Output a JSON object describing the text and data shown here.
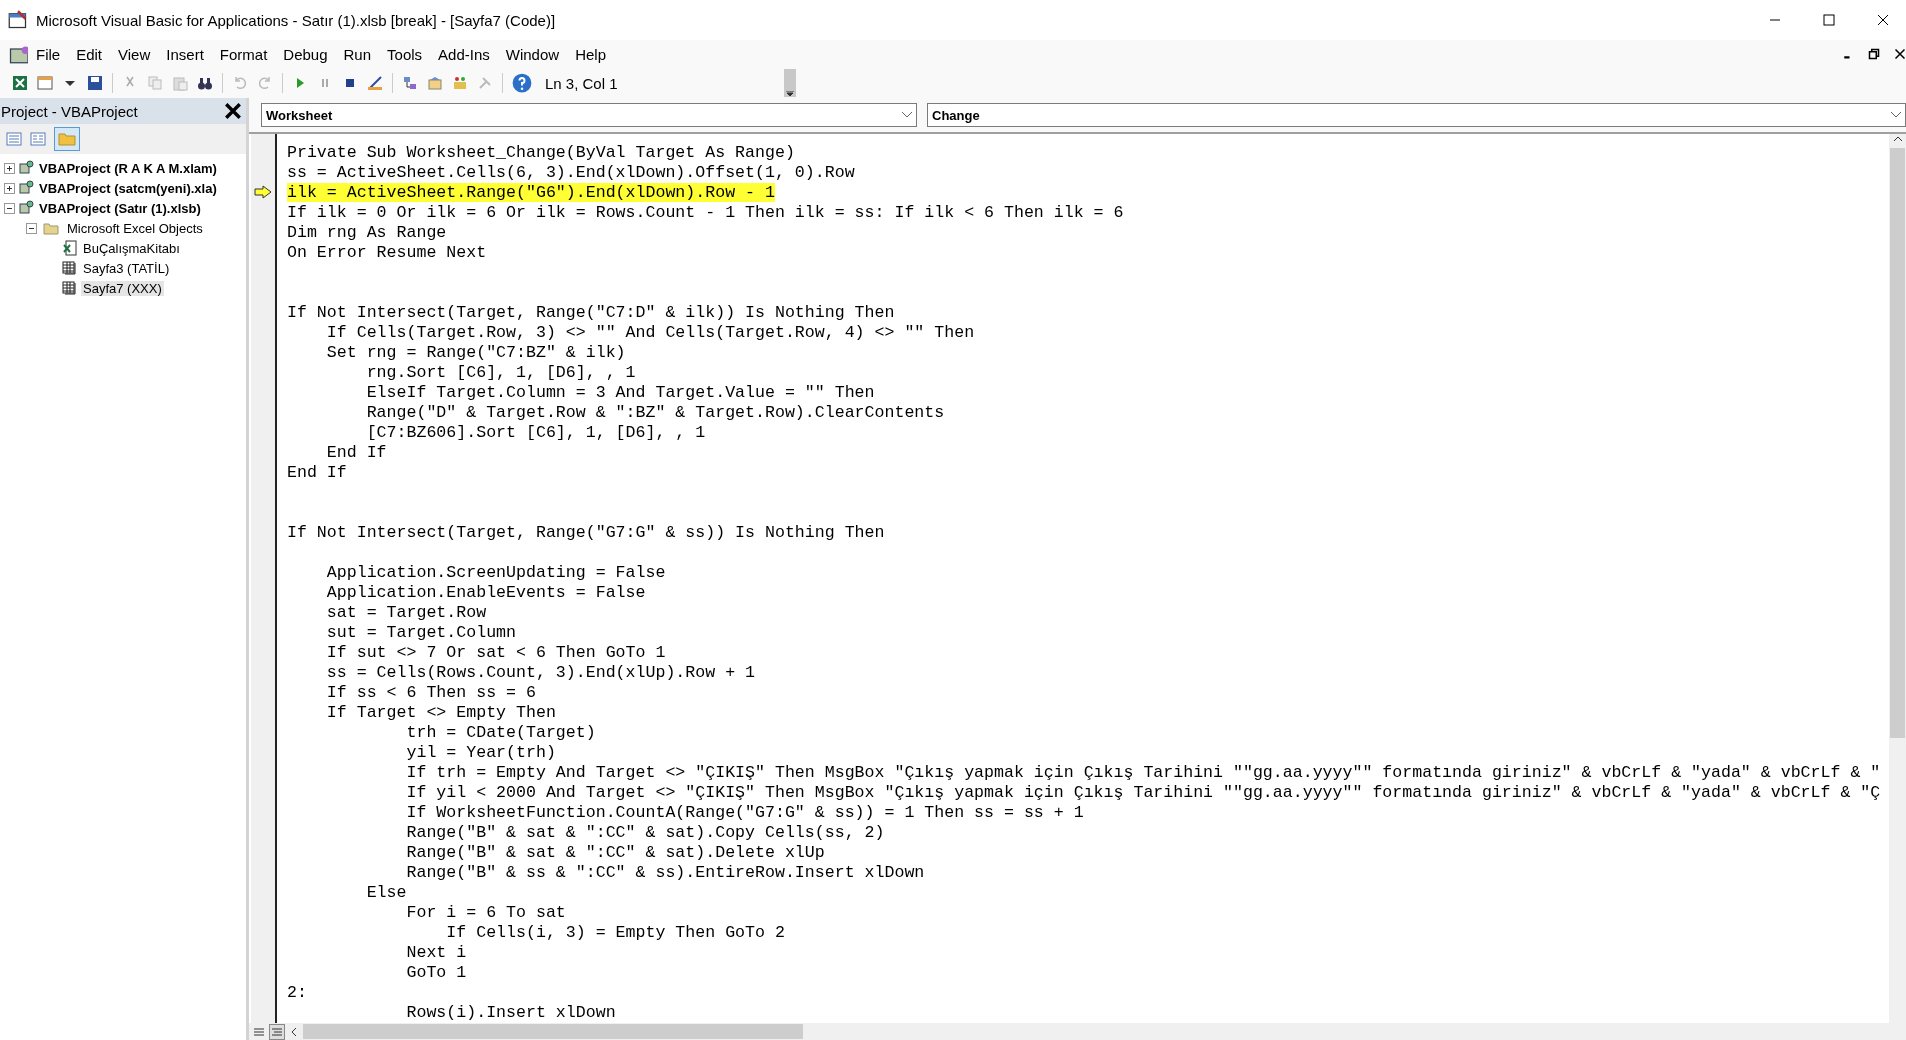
{
  "window": {
    "title": "Microsoft Visual Basic for Applications - Satır (1).xlsb [break] - [Sayfa7 (Code)]"
  },
  "menu": [
    {
      "label": "File"
    },
    {
      "label": "Edit"
    },
    {
      "label": "View"
    },
    {
      "label": "Insert"
    },
    {
      "label": "Format"
    },
    {
      "label": "Debug"
    },
    {
      "label": "Run"
    },
    {
      "label": "Tools"
    },
    {
      "label": "Add-Ins"
    },
    {
      "label": "Window"
    },
    {
      "label": "Help"
    }
  ],
  "toolbar": {
    "position": "Ln 3, Col 1"
  },
  "project": {
    "title": "Project - VBAProject",
    "folders_toggle": {
      "selected": true
    },
    "tree": [
      {
        "label": "VBAProject (R A K A M.xlam)",
        "kind": "project",
        "expanded": false,
        "selected": false
      },
      {
        "label": "VBAProject (satcm(yeni).xla)",
        "kind": "project",
        "expanded": false,
        "selected": false
      },
      {
        "label": "VBAProject (Satır (1).xlsb)",
        "kind": "project",
        "expanded": true,
        "selected": false,
        "children": [
          {
            "label": "Microsoft Excel Objects",
            "kind": "folder",
            "expanded": true,
            "selected": false,
            "children": [
              {
                "label": "BuÇalışmaKitabı",
                "kind": "workbook",
                "selected": false
              },
              {
                "label": "Sayfa3 (TATİL)",
                "kind": "sheet",
                "selected": false
              },
              {
                "label": "Sayfa7 (XXX)",
                "kind": "sheet",
                "selected": true
              }
            ]
          }
        ]
      }
    ]
  },
  "code": {
    "object": "Worksheet",
    "procedure": "Change",
    "lines": [
      {
        "kind": "code",
        "text": "Private Sub Worksheet_Change(ByVal Target As Range)",
        "current": false
      },
      {
        "kind": "code",
        "text": "ss = ActiveSheet.Cells(6, 3).End(xlDown).Offset(1, 0).Row",
        "current": false
      },
      {
        "kind": "code",
        "text": "ilk = ActiveSheet.Range(\"G6\").End(xlDown).Row - 1",
        "current": true
      },
      {
        "kind": "code",
        "text": "If ilk = 0 Or ilk = 6 Or ilk = Rows.Count - 1 Then ilk = ss: If ilk < 6 Then ilk = 6",
        "current": false
      },
      {
        "kind": "code",
        "text": "Dim rng As Range",
        "current": false
      },
      {
        "kind": "code",
        "text": "On Error Resume Next",
        "current": false
      },
      {
        "kind": "blank"
      },
      {
        "kind": "blank"
      },
      {
        "kind": "code",
        "text": "If Not Intersect(Target, Range(\"C7:D\" & ilk)) Is Nothing Then",
        "current": false
      },
      {
        "kind": "code",
        "text": "    If Cells(Target.Row, 3) <> \"\" And Cells(Target.Row, 4) <> \"\" Then",
        "current": false
      },
      {
        "kind": "code",
        "text": "    Set rng = Range(\"C7:BZ\" & ilk)",
        "current": false
      },
      {
        "kind": "code",
        "text": "        rng.Sort [C6], 1, [D6], , 1",
        "current": false
      },
      {
        "kind": "code",
        "text": "        ElseIf Target.Column = 3 And Target.Value = \"\" Then",
        "current": false
      },
      {
        "kind": "code",
        "text": "        Range(\"D\" & Target.Row & \":BZ\" & Target.Row).ClearContents",
        "current": false
      },
      {
        "kind": "code",
        "text": "        [C7:BZ606].Sort [C6], 1, [D6], , 1",
        "current": false
      },
      {
        "kind": "code",
        "text": "    End If",
        "current": false
      },
      {
        "kind": "code",
        "text": "End If",
        "current": false
      },
      {
        "kind": "blank"
      },
      {
        "kind": "blank"
      },
      {
        "kind": "code",
        "text": "If Not Intersect(Target, Range(\"G7:G\" & ss)) Is Nothing Then",
        "current": false
      },
      {
        "kind": "blank"
      },
      {
        "kind": "code",
        "text": "    Application.ScreenUpdating = False",
        "current": false
      },
      {
        "kind": "code",
        "text": "    Application.EnableEvents = False",
        "current": false
      },
      {
        "kind": "code",
        "text": "    sat = Target.Row",
        "current": false
      },
      {
        "kind": "code",
        "text": "    sut = Target.Column",
        "current": false
      },
      {
        "kind": "code",
        "text": "    If sut <> 7 Or sat < 6 Then GoTo 1",
        "current": false
      },
      {
        "kind": "code",
        "text": "    ss = Cells(Rows.Count, 3).End(xlUp).Row + 1",
        "current": false
      },
      {
        "kind": "code",
        "text": "    If ss < 6 Then ss = 6",
        "current": false
      },
      {
        "kind": "code",
        "text": "    If Target <> Empty Then",
        "current": false
      },
      {
        "kind": "code",
        "text": "            trh = CDate(Target)",
        "current": false
      },
      {
        "kind": "code",
        "text": "            yil = Year(trh)",
        "current": false
      },
      {
        "kind": "code",
        "text": "            If trh = Empty And Target <> \"ÇIKIŞ\" Then MsgBox \"Çıkış yapmak için Çıkış Tarihini \"\"gg.aa.yyyy\"\" formatında giriniz\" & vbCrLf & \"yada\" & vbCrLf & \"",
        "current": false
      },
      {
        "kind": "code",
        "text": "            If yil < 2000 And Target <> \"ÇIKIŞ\" Then MsgBox \"Çıkış yapmak için Çıkış Tarihini \"\"gg.aa.yyyy\"\" formatında giriniz\" & vbCrLf & \"yada\" & vbCrLf & \"Ç",
        "current": false
      },
      {
        "kind": "code",
        "text": "            If WorksheetFunction.CountA(Range(\"G7:G\" & ss)) = 1 Then ss = ss + 1",
        "current": false
      },
      {
        "kind": "code",
        "text": "            Range(\"B\" & sat & \":CC\" & sat).Copy Cells(ss, 2)",
        "current": false
      },
      {
        "kind": "code",
        "text": "            Range(\"B\" & sat & \":CC\" & sat).Delete xlUp",
        "current": false
      },
      {
        "kind": "code",
        "text": "            Range(\"B\" & ss & \":CC\" & ss).EntireRow.Insert xlDown",
        "current": false
      },
      {
        "kind": "code",
        "text": "        Else",
        "current": false
      },
      {
        "kind": "code",
        "text": "            For i = 6 To sat",
        "current": false
      },
      {
        "kind": "code",
        "text": "                If Cells(i, 3) = Empty Then GoTo 2",
        "current": false
      },
      {
        "kind": "code",
        "text": "            Next i",
        "current": false
      },
      {
        "kind": "code",
        "text": "            GoTo 1",
        "current": false
      },
      {
        "kind": "code",
        "text": "2:",
        "current": false
      },
      {
        "kind": "code",
        "text": "            Rows(i).Insert xlDown",
        "current": false
      }
    ]
  }
}
